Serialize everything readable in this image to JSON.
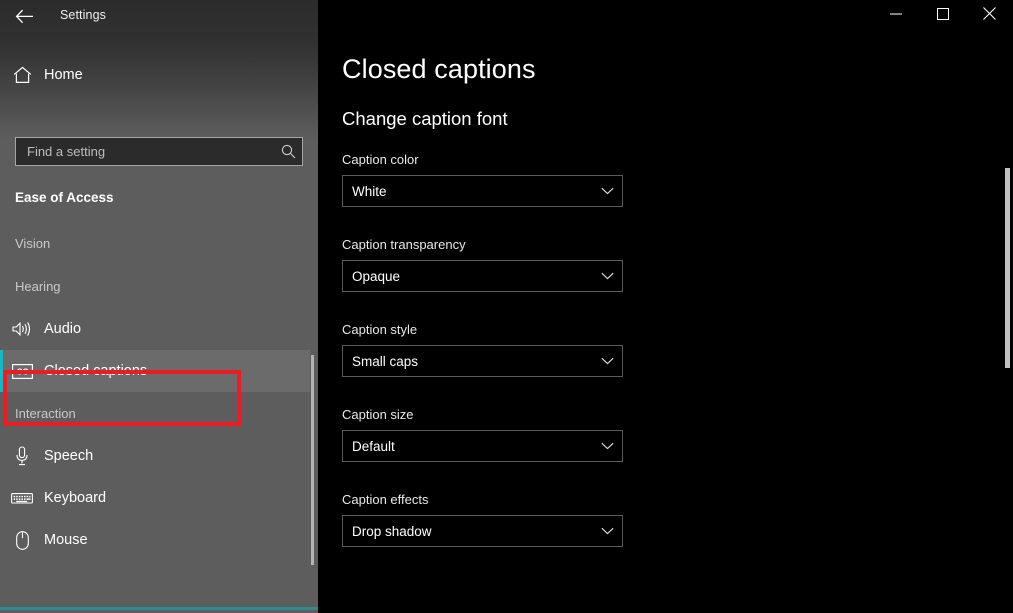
{
  "window": {
    "title": "Settings",
    "back_icon": "back-arrow-icon",
    "controls": [
      {
        "name": "minimize-button",
        "icon": "minimize-icon",
        "label": "Minimize"
      },
      {
        "name": "maximize-button",
        "icon": "maximize-icon",
        "label": "Maximize"
      },
      {
        "name": "close-button",
        "icon": "close-icon",
        "label": "Close"
      }
    ]
  },
  "sidebar": {
    "home": {
      "label": "Home",
      "icon": "home-icon"
    },
    "search": {
      "placeholder": "Find a setting",
      "value": "",
      "icon": "search-icon"
    },
    "category": "Ease of Access",
    "groups": [
      {
        "header": "Vision",
        "items": []
      },
      {
        "header": "Hearing",
        "items": [
          {
            "label": "Audio",
            "icon": "speaker-volume-icon",
            "selected": false
          },
          {
            "label": "Closed captions",
            "icon": "closed-captions-icon",
            "selected": true
          }
        ]
      },
      {
        "header": "Interaction",
        "items": [
          {
            "label": "Speech",
            "icon": "microphone-icon",
            "selected": false
          },
          {
            "label": "Keyboard",
            "icon": "keyboard-icon",
            "selected": false
          },
          {
            "label": "Mouse",
            "icon": "mouse-icon",
            "selected": false
          }
        ]
      }
    ],
    "accent_color": "#17b8c4",
    "bottom_accent_color": "#2e8b8f"
  },
  "main": {
    "page_title": "Closed captions",
    "section_title": "Change caption font",
    "fields": [
      {
        "label": "Caption color",
        "value": "White",
        "name": "caption-color"
      },
      {
        "label": "Caption transparency",
        "value": "Opaque",
        "name": "caption-transparency"
      },
      {
        "label": "Caption style",
        "value": "Small caps",
        "name": "caption-style"
      },
      {
        "label": "Caption size",
        "value": "Default",
        "name": "caption-size"
      },
      {
        "label": "Caption effects",
        "value": "Drop shadow",
        "name": "caption-effects"
      }
    ]
  },
  "annotation": {
    "highlight_color": "#ed1c24",
    "target": "Closed captions"
  }
}
